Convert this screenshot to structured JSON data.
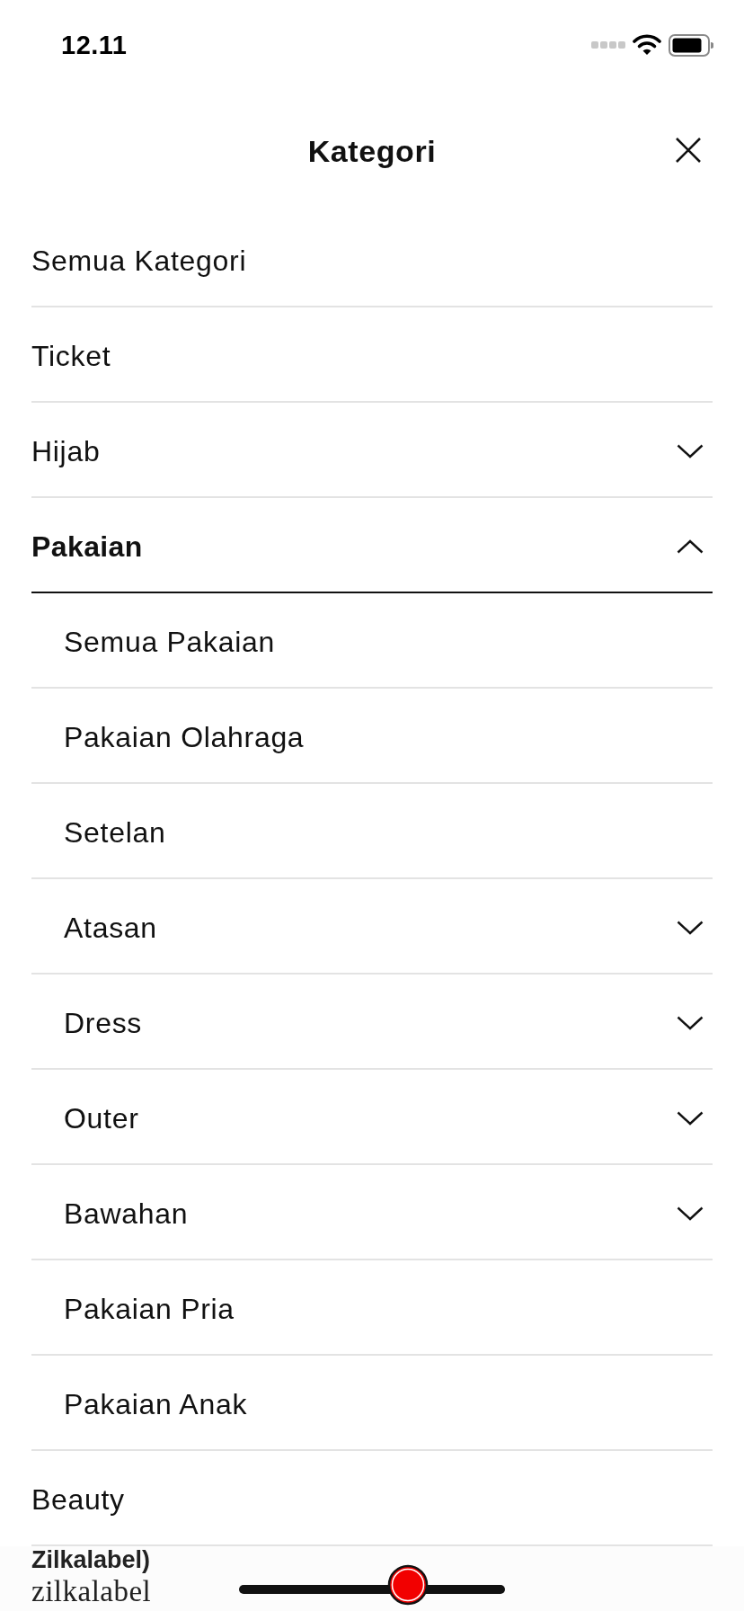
{
  "status_bar": {
    "time": "12.11"
  },
  "header": {
    "title": "Kategori"
  },
  "categories": [
    {
      "label": "Semua Kategori",
      "kind": "leaf",
      "expanded": false
    },
    {
      "label": "Ticket",
      "kind": "leaf",
      "expanded": false
    },
    {
      "label": "Hijab",
      "kind": "group",
      "expanded": false
    },
    {
      "label": "Pakaian",
      "kind": "group",
      "expanded": true,
      "children": [
        {
          "label": "Semua Pakaian",
          "kind": "leaf",
          "expanded": false
        },
        {
          "label": "Pakaian Olahraga",
          "kind": "leaf",
          "expanded": false
        },
        {
          "label": "Setelan",
          "kind": "leaf",
          "expanded": false
        },
        {
          "label": "Atasan",
          "kind": "group",
          "expanded": false
        },
        {
          "label": "Dress",
          "kind": "group",
          "expanded": false
        },
        {
          "label": "Outer",
          "kind": "group",
          "expanded": false
        },
        {
          "label": "Bawahan",
          "kind": "group",
          "expanded": false
        },
        {
          "label": "Pakaian Pria",
          "kind": "leaf",
          "expanded": false
        },
        {
          "label": "Pakaian Anak",
          "kind": "leaf",
          "expanded": false
        }
      ]
    },
    {
      "label": "Beauty",
      "kind": "leaf",
      "expanded": false
    }
  ],
  "footer": {
    "caption": "Zilkalabel)",
    "brand": "zilkalabel"
  }
}
